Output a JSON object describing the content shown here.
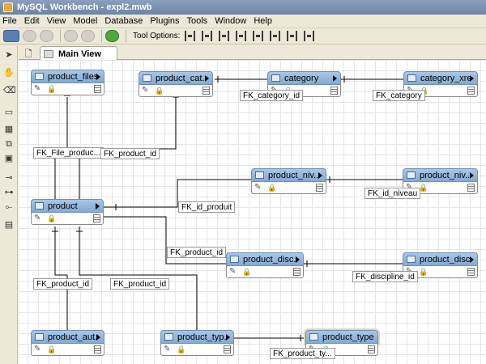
{
  "window": {
    "title": "MySQL Workbench - expl2.mwb"
  },
  "menu": [
    "File",
    "Edit",
    "View",
    "Model",
    "Database",
    "Plugins",
    "Tools",
    "Window",
    "Help"
  ],
  "toolbar": {
    "tool_options_label": "Tool Options:"
  },
  "tabs": {
    "active": "Main View"
  },
  "entities": {
    "product_files": "product_files",
    "product_cat": "product_cat...",
    "category": "category",
    "category_xref": "category_xref",
    "product": "product",
    "product_niv_a": "product_niv...",
    "product_niv_b": "product_niv...",
    "product_disc_a": "product_disc...",
    "product_disc_b": "product_disc...",
    "product_aut": "product_aut...",
    "product_typ": "product_typ...",
    "product_type": "product_type"
  },
  "fk_labels": {
    "fk_category_id": "FK_category_id",
    "fk_category": "FK_category",
    "fk_file_product": "FK_File_produc...",
    "fk_product_id_top": "FK_product_id",
    "fk_id_produit": "FK_id_produit",
    "fk_id_niveau": "FK_id_niveau",
    "fk_product_id_mid": "FK_product_id",
    "fk_discipline_id": "FK_discipline_id",
    "fk_product_id_left": "FK_product_id",
    "fk_product_id_center": "FK_product_id",
    "fk_product_ty": "FK_product_ty..."
  },
  "colors": {
    "entity_header": "#8fb2da",
    "canvas": "#ffffff",
    "grid": "#e6e6e6"
  },
  "icons": [
    "app-icon",
    "pointer-tool-icon",
    "hand-tool-icon",
    "eraser-tool-icon",
    "layer-tool-icon",
    "table-tool-icon",
    "view-tool-icon",
    "routine-tool-icon",
    "relationship-tool-icon",
    "note-tool-icon",
    "pencil-icon",
    "lock-icon",
    "rows-icon"
  ]
}
